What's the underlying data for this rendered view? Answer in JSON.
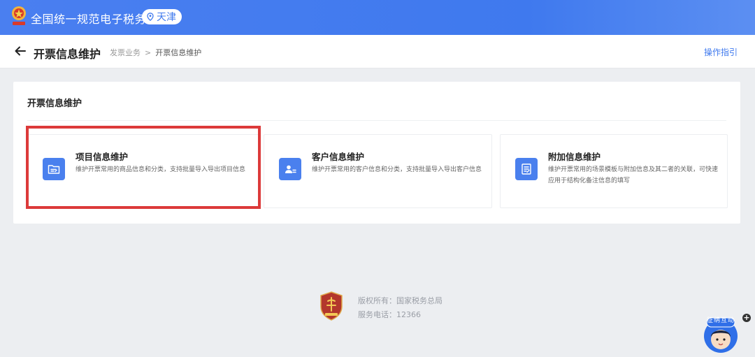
{
  "header": {
    "site_title": "全国统一规范电子税务局",
    "region": "天津"
  },
  "subheader": {
    "page_title": "开票信息维护",
    "breadcrumb": [
      "发票业务",
      "开票信息维护"
    ],
    "breadcrumb_separator": ">",
    "guide_link": "操作指引"
  },
  "main": {
    "section_title": "开票信息维护",
    "cards": [
      {
        "title": "项目信息维护",
        "desc": "维护开票常用的商品信息和分类，支持批量导入导出项目信息",
        "icon": "folder-list-icon"
      },
      {
        "title": "客户信息维护",
        "desc": "维护开票常用的客户信息和分类，支持批量导入导出客户信息",
        "icon": "contact-card-icon"
      },
      {
        "title": "附加信息维护",
        "desc": "维护开票常用的场景模板与附加信息及其二者的关联，可快速应用于结构化备注信息的填写",
        "icon": "form-edit-icon"
      }
    ]
  },
  "footer": {
    "copyright": "版权所有：国家税务总局",
    "phone": "服务电话：12366"
  },
  "assistant": {
    "label": "征纳互动",
    "plus": "+"
  },
  "colors": {
    "primary": "#3f79ee",
    "highlight": "#dc3a3a",
    "background": "#eceef1"
  }
}
